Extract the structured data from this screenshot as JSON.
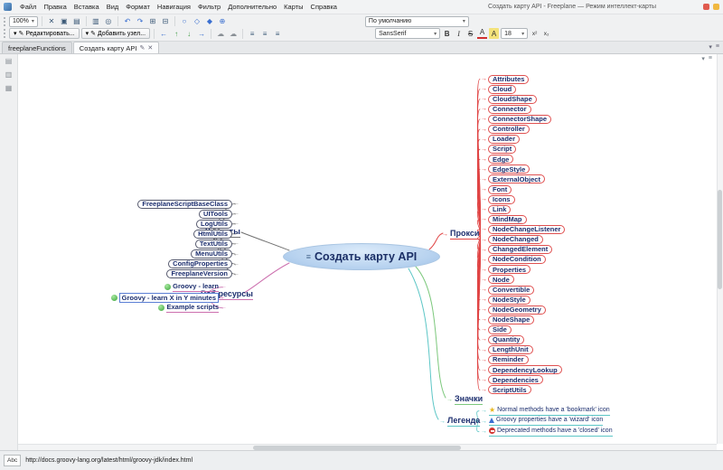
{
  "window": {
    "title": "Создать карту API - Freeplane — Режим интеллект-карты"
  },
  "menubar": {
    "items": [
      "Файл",
      "Правка",
      "Вставка",
      "Вид",
      "Формат",
      "Навигация",
      "Фильтр",
      "Дополнительно",
      "Карты",
      "Справка"
    ]
  },
  "toolbar": {
    "zoom_value": "100%",
    "edit_label": "Редактировать...",
    "add_node_label": "Добавить узел...",
    "style_value": "По умолчанию",
    "font_value": "SansSerif",
    "size_value": "18",
    "format": {
      "bold": "B",
      "italic": "I",
      "strike": "S",
      "color": "A",
      "highlight": "A",
      "superscript": "x²",
      "subscript": "x₂"
    }
  },
  "tabs": {
    "items": [
      {
        "label": "freeplaneFunctions"
      },
      {
        "label": "Создать карту API"
      }
    ]
  },
  "icons": {
    "dropdown": "▾",
    "cut": "✕",
    "copy": "▣",
    "paste": "▤",
    "print": "▥",
    "find": "◎",
    "undo": "↶",
    "redo": "↷",
    "unfold": "⊞",
    "fold": "⊟",
    "circle": "○",
    "diamond_open": "◇",
    "diamond_filled": "◆",
    "circle_plus": "⊕",
    "pencil": "✎",
    "cloud": "☁",
    "align": "≡",
    "arrow_left": "←",
    "arrow_right": "→",
    "arrow_up": "↑",
    "arrow_down": "↓",
    "root_icon": "≡",
    "star": "★",
    "close": "✕",
    "menu": "≡",
    "collapse": "▾",
    "panel1": "▤",
    "panel2": "▥",
    "panel3": "▦"
  },
  "map": {
    "root_label": "Создать карту API",
    "colors": {
      "proxy": "#e04545",
      "utils": "#707070",
      "web": "#cc6fae",
      "icons": "#7cc87c",
      "legend": "#5cc6c6"
    },
    "left": {
      "utils": {
        "label": "Утилиты",
        "children": [
          "FreeplaneScriptBaseClass",
          "UITools",
          "LogUtils",
          "HtmlUtils",
          "TextUtils",
          "MenuUtils",
          "ConfigProperties",
          "FreeplaneVersion"
        ]
      },
      "web": {
        "label": "Веб ресурсы",
        "children": [
          {
            "label": "Groovy - learn"
          },
          {
            "label": "Groovy - learn X in Y minutes"
          },
          {
            "label": "Example scripts"
          }
        ]
      }
    },
    "right": {
      "proxy": {
        "label": "Прокси",
        "children": [
          "Attributes",
          "Cloud",
          "CloudShape",
          "Connector",
          "ConnectorShape",
          "Controller",
          "Loader",
          "Script",
          "Edge",
          "EdgeStyle",
          "ExternalObject",
          "Font",
          "Icons",
          "Link",
          "MindMap",
          "NodeChangeListener",
          "NodeChanged",
          "ChangedElement",
          "NodeCondition",
          "Properties",
          "Node",
          "Convertible",
          "NodeStyle",
          "NodeGeometry",
          "NodeShape",
          "Side",
          "Quantity",
          "LengthUnit",
          "Reminder",
          "DependencyLookup",
          "Dependencies",
          "ScriptUtils"
        ]
      },
      "icons_branch": {
        "label": "Значки"
      },
      "legend": {
        "label": "Легенда",
        "children": [
          {
            "icon": "bookmark",
            "label": "Normal methods have a 'bookmark' icon"
          },
          {
            "icon": "wizard",
            "label": "Groovy properties have a 'wizard' icon"
          },
          {
            "icon": "closed",
            "label": "Deprecated methods have a 'closed' icon"
          }
        ]
      }
    }
  },
  "statusbar": {
    "spell_badge": "Abc",
    "link": "http://docs.groovy-lang.org/latest/html/groovy-jdk/index.html"
  }
}
